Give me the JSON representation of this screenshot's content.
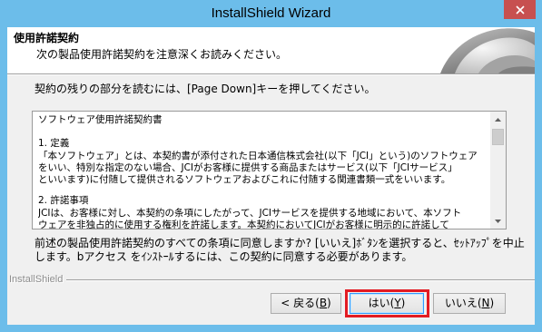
{
  "window": {
    "title": "InstallShield Wizard"
  },
  "header": {
    "title": "使用許諾契約",
    "subtitle": "次の製品使用許諾契約を注意深くお読みください。"
  },
  "instruction": "契約の残りの部分を読むには、[Page Down]キーを押してください。",
  "license": {
    "title": "ソフトウェア使用許諾契約書",
    "sections": [
      {
        "heading": "1. 定義",
        "lines": [
          "「本ソフトウェア」とは、本契約書が添付された日本通信株式会社(以下「JCI」という)のソフトウェア",
          "をいい、特別な指定のない場合、JCIがお客様に提供する商品またはサービス(以下「JCIサービス」",
          "といいます)に付随して提供されるソフトウェアおよびこれに付随する関連書類一式をいいます。"
        ]
      },
      {
        "heading": "2. 許諾事項",
        "lines": [
          "JCIは、お客様に対し、本契約の条項にしたがって、JCIサービスを提供する地域において、本ソフト",
          "ウェアを非独占的に使用する権利を許諾します。本契約においてJCIがお客様に明示的に許諾して"
        ]
      }
    ],
    "scrollbar_position": 0
  },
  "prompt": {
    "lines": [
      "前述の製品使用許諾契約のすべての条項に同意しますか? [いいえ]ﾎﾞﾀﾝを選択すると、ｾｯﾄｱｯﾌﾟを中止",
      "します。bアクセス をｲﾝｽﾄｰﾙするには、この契約に同意する必要があります。"
    ]
  },
  "footer": {
    "brand": "InstallShield"
  },
  "buttons": {
    "back": {
      "prefix": "< 戻る(",
      "key": "B",
      "suffix": ")"
    },
    "yes": {
      "prefix": "はい(",
      "key": "Y",
      "suffix": ")",
      "is_default": true,
      "highlighted": true
    },
    "no": {
      "prefix": "いいえ(",
      "key": "N",
      "suffix": ")"
    }
  },
  "icons": {
    "close": "close-icon",
    "scroll_up": "scroll-up-arrow-icon",
    "scroll_down": "scroll-down-arrow-icon",
    "banner": "installshield-banner-graphic"
  },
  "colors": {
    "titlebar": "#6CBDEA",
    "close": "#C75050",
    "highlight": "#E31B23",
    "default-border": "#3399FF"
  }
}
